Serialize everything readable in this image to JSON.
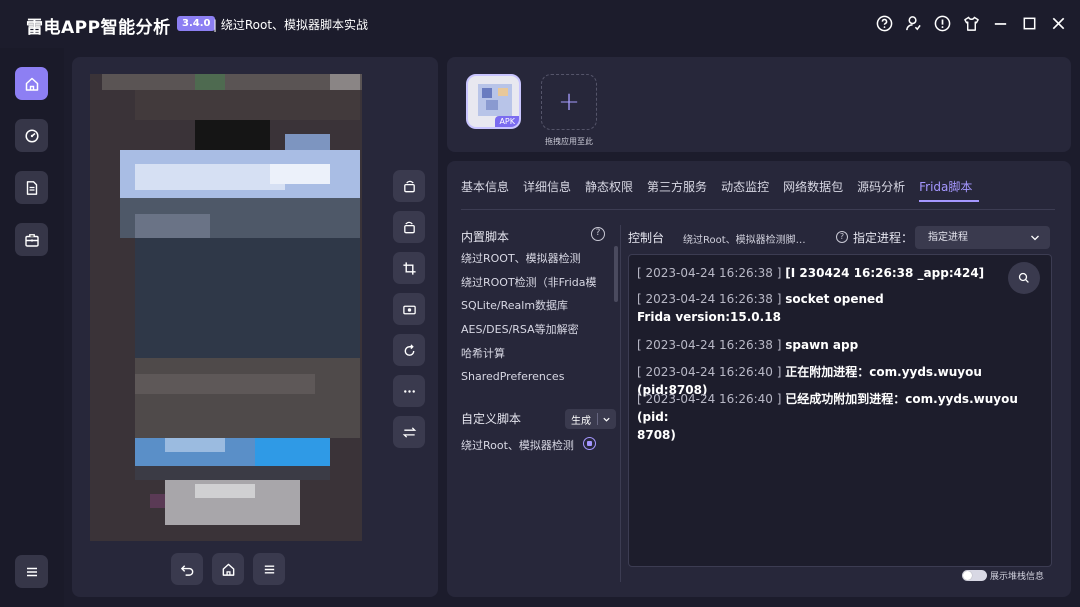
{
  "titlebar": {
    "app_title": "雷电APP智能分析",
    "version": "3.4.0",
    "subtitle": "| 绕过Root、模拟器脚本实战",
    "icons": [
      "help-icon",
      "user-icon",
      "info-icon",
      "shirt-icon",
      "minimize-icon",
      "maximize-icon",
      "close-icon"
    ]
  },
  "nav": {
    "items": [
      "home-icon",
      "analysis-icon",
      "document-icon",
      "toolbox-icon"
    ],
    "menu_icon": "menu-icon",
    "active_color": "#8d7ff3"
  },
  "device_tools": [
    "rotate-icon",
    "rotate-alt-icon",
    "crop-icon",
    "record-icon",
    "refresh-icon",
    "more-icon",
    "switch-icon"
  ],
  "device_nav": [
    "back-icon",
    "home-icon",
    "menu-icon"
  ],
  "app_selector": {
    "apk_tag": "APK",
    "add_label": "拖拽应用至此"
  },
  "tabs": [
    "基本信息",
    "详细信息",
    "静态权限",
    "第三方服务",
    "动态监控",
    "网络数据包",
    "源码分析",
    "Frida脚本"
  ],
  "active_tab": "Frida脚本",
  "builtin": {
    "title": "内置脚本",
    "items": [
      "绕过ROOT、模拟器检测",
      "绕过ROOT检测（非Frida模",
      "SQLite/Realm数据库",
      "AES/DES/RSA等加解密",
      "哈希计算",
      "SharedPreferences"
    ]
  },
  "custom": {
    "title": "自定义脚本",
    "generate_label": "生成",
    "items": [
      "绕过Root、模拟器检测"
    ]
  },
  "console": {
    "label": "控制台",
    "script_name": "绕过Root、模拟器检测脚…",
    "process_label": "指定进程：",
    "process_value": "指定进程",
    "logs": [
      {
        "ts": "[ 2023-04-24 16:26:38 ]",
        "msg": "[I 230424 16:26:38 _app:424]"
      },
      {
        "ts": "[ 2023-04-24 16:26:38 ]",
        "msg": "socket opened",
        "extra": "Frida version:15.0.18"
      },
      {
        "ts": "[ 2023-04-24 16:26:38 ]",
        "msg": "spawn app"
      },
      {
        "ts": "[ 2023-04-24 16:26:40 ]",
        "msg": "正在附加进程：com.yyds.wuyou (pid:8708)"
      },
      {
        "ts": "[ 2023-04-24 16:26:40 ]",
        "msg": "已经成功附加到进程：com.yyds.wuyou (pid:",
        "extra": "8708)"
      }
    ]
  },
  "stack_toggle_label": "展示堆栈信息",
  "colors": {
    "accent": "#a597ff",
    "background": "#1c1c2c",
    "panel": "#27273a"
  }
}
